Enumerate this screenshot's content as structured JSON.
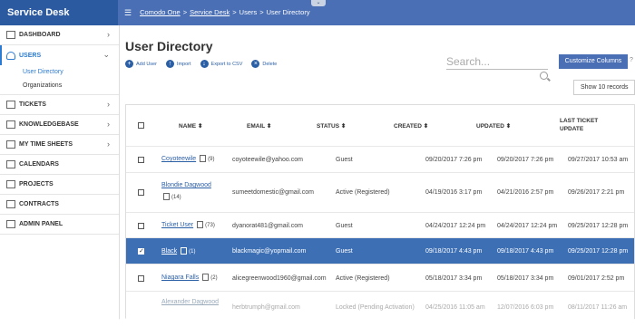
{
  "topbar": {
    "brand": "Service Desk",
    "crumbs": [
      "Comodo One",
      "Service Desk",
      "Users",
      "User Directory"
    ]
  },
  "sidebar": {
    "items": [
      {
        "label": "DASHBOARD",
        "icon": "dashboard-icon",
        "chevron": true
      },
      {
        "label": "USERS",
        "icon": "user-icon",
        "chevron": true,
        "active": true
      },
      {
        "label": "TICKETS",
        "icon": "ticket-icon",
        "chevron": true
      },
      {
        "label": "KNOWLEDGEBASE",
        "icon": "book-icon",
        "chevron": true
      },
      {
        "label": "MY TIME SHEETS",
        "icon": "timesheet-icon",
        "chevron": true
      },
      {
        "label": "CALENDARS",
        "icon": "calendar-icon",
        "chevron": false
      },
      {
        "label": "PROJECTS",
        "icon": "folder-icon",
        "chevron": false
      },
      {
        "label": "CONTRACTS",
        "icon": "contract-icon",
        "chevron": false
      },
      {
        "label": "ADMIN PANEL",
        "icon": "admin-icon",
        "chevron": false
      }
    ],
    "users_sub": [
      "User Directory",
      "Organizations"
    ]
  },
  "main": {
    "title": "User Directory",
    "toolbar": {
      "add": "Add User",
      "import": "Import",
      "export": "Export to CSV",
      "delete": "Delete"
    },
    "search_placeholder": "Search...",
    "customize_label": "Customize Columns",
    "help": "?",
    "show_select": "Show 10 records"
  },
  "table": {
    "headers": {
      "name": "NAME ⬍",
      "email": "EMAIL ⬍",
      "status": "STATUS ⬍",
      "created": "CREATED ⬍",
      "updated": "UPDATED ⬍",
      "last_ticket": "LAST TICKET",
      "last_ticket_2": "UPDATE"
    },
    "rows": [
      {
        "name": "Coyoteewile",
        "count": "(9)",
        "email": "coyoteewile@yahoo.com",
        "status": "Guest",
        "created": "09/20/2017 7:26 pm",
        "updated": "09/20/2017 7:26 pm",
        "last": "09/27/2017 10:53 am"
      },
      {
        "name": "Blondie Dagwood",
        "count": "(14)",
        "email": "sumeetdomestic@gmail.com",
        "status": "Active (Registered)",
        "created": "04/19/2016 3:17 pm",
        "updated": "04/21/2016 2:57 pm",
        "last": "09/26/2017 2:21 pm"
      },
      {
        "name": "Ticket User",
        "count": "(73)",
        "email": "dyanorat481@gmail.com",
        "status": "Guest",
        "created": "04/24/2017 12:24 pm",
        "updated": "04/24/2017 12:24 pm",
        "last": "09/25/2017 12:28 pm"
      },
      {
        "name": "Black",
        "count": "(1)",
        "email": "blackmagic@yopmail.com",
        "status": "Guest",
        "created": "09/18/2017 4:43 pm",
        "updated": "09/18/2017 4:43 pm",
        "last": "09/25/2017 12:28 pm"
      },
      {
        "name": "Niagara Falls",
        "count": "(2)",
        "email": "alicegreenwood1960@gmail.com",
        "status": "Active (Registered)",
        "created": "05/18/2017 3:34 pm",
        "updated": "05/18/2017 3:34 pm",
        "last": "09/01/2017 2:52 pm"
      },
      {
        "name": "Alexander Dagwood",
        "count": "",
        "email": "herbtrumph@gmail.com",
        "status": "Locked (Pending Activation)",
        "created": "04/25/2016 11:05 am",
        "updated": "12/07/2016 6:03 pm",
        "last": "08/11/2017 11:26 am"
      }
    ]
  }
}
